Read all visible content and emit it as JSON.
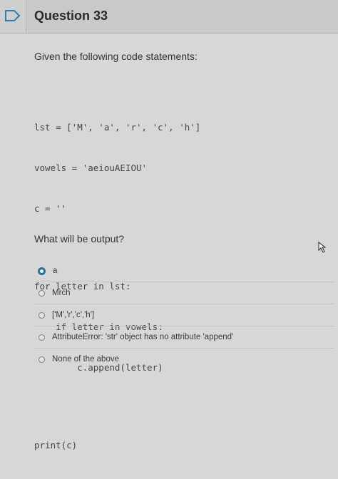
{
  "header": {
    "title": "Question 33",
    "flag_icon": "flag-outline-icon"
  },
  "prompt": "Given the following code statements:",
  "code_lines": [
    "lst = ['M', 'a', 'r', 'c', 'h']",
    "vowels = 'aeiouAEIOU'",
    "c = ''",
    "",
    "for letter in lst:",
    "    if letter in vowels:",
    "        c.append(letter)",
    "",
    "print(c)"
  ],
  "question": "What will be output?",
  "options": [
    {
      "label": "a",
      "selected": true
    },
    {
      "label": "Mrch",
      "selected": false
    },
    {
      "label": "['M','r','c','h']",
      "selected": false
    },
    {
      "label": "AttributeError: 'str' object has no attribute 'append'",
      "selected": false
    },
    {
      "label": "None of the above",
      "selected": false
    }
  ],
  "colors": {
    "accent": "#1f73a8",
    "background": "#d7d7d5"
  }
}
